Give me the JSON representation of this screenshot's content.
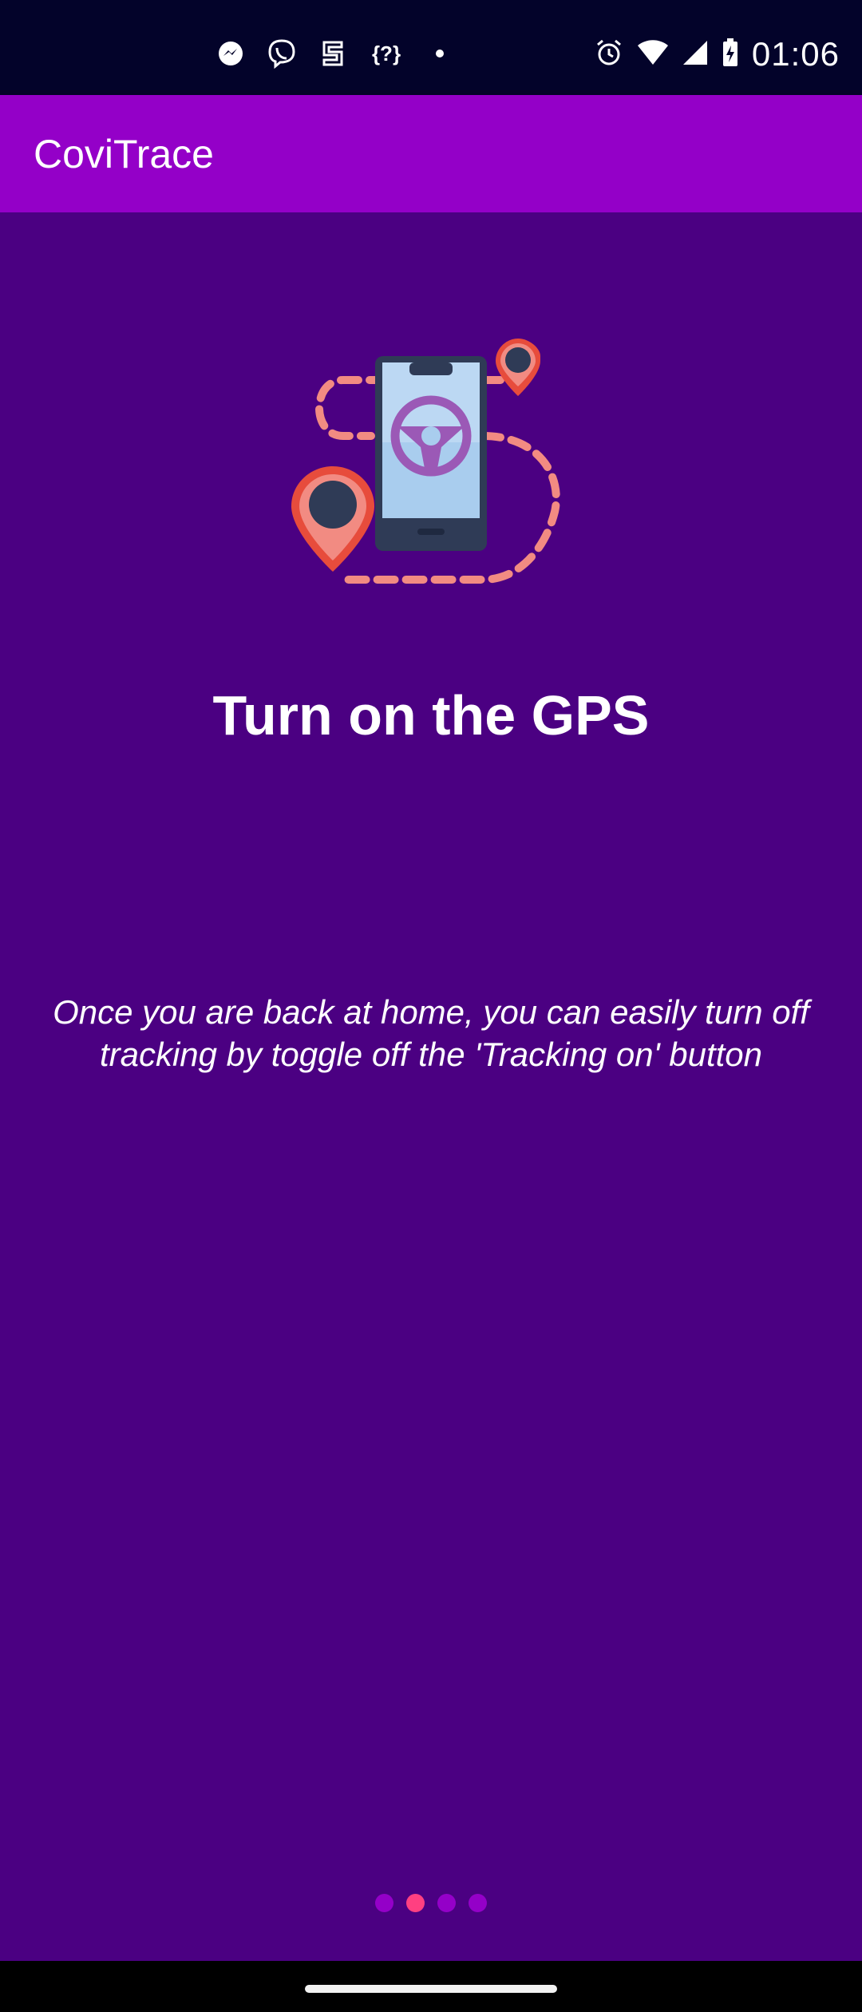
{
  "status_bar": {
    "time": "01:06",
    "notification_icons": [
      "messenger-icon",
      "viber-icon",
      "samsung-health-icon",
      "unknown-app-icon",
      "more-dot-icon"
    ],
    "system_icons": [
      "alarm-icon",
      "wifi-icon",
      "cell-signal-icon",
      "battery-charging-icon"
    ]
  },
  "app_bar": {
    "title": "CoviTrace"
  },
  "onboarding": {
    "illustration_icon": "gps-route-phone-illustration",
    "heading": "Turn on the GPS",
    "description": "Once you are back at home, you can easily turn off tracking by toggle off the 'Tracking on' button",
    "page_indicator": {
      "total": 4,
      "current": 2
    }
  },
  "colors": {
    "status_bar": "#03032a",
    "app_bar": "#9400c8",
    "background": "#4b0082",
    "indicator_active": "#ff4081",
    "indicator_inactive": "#9400c8"
  }
}
